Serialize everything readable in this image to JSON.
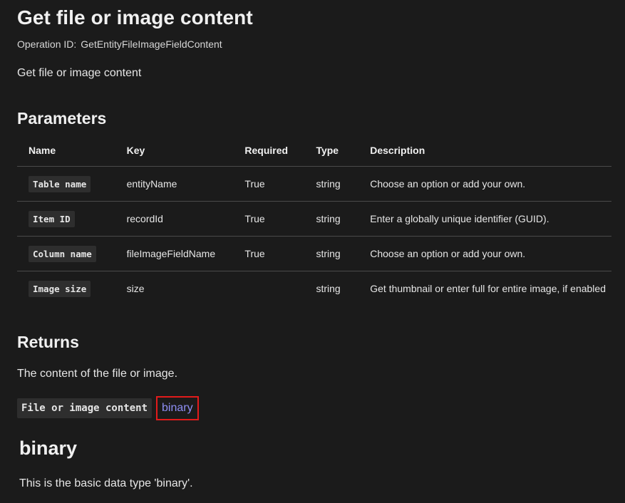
{
  "title": "Get file or image content",
  "operation": {
    "label": "Operation ID:",
    "value": "GetEntityFileImageFieldContent"
  },
  "summary": "Get file or image content",
  "parameters": {
    "heading": "Parameters",
    "columns": [
      "Name",
      "Key",
      "Required",
      "Type",
      "Description"
    ],
    "rows": [
      {
        "name": "Table name",
        "key": "entityName",
        "required": "True",
        "type": "string",
        "description": "Choose an option or add your own."
      },
      {
        "name": "Item ID",
        "key": "recordId",
        "required": "True",
        "type": "string",
        "description": "Enter a globally unique identifier (GUID)."
      },
      {
        "name": "Column name",
        "key": "fileImageFieldName",
        "required": "True",
        "type": "string",
        "description": "Choose an option or add your own."
      },
      {
        "name": "Image size",
        "key": "size",
        "required": "",
        "type": "string",
        "description": "Get thumbnail or enter full for entire image, if enabled"
      }
    ]
  },
  "returns": {
    "heading": "Returns",
    "description": "The content of the file or image.",
    "name": "File or image content",
    "type_link": "binary",
    "highlight_color": "#e21b1b",
    "link_color": "#8f8ff5"
  },
  "binary": {
    "heading": "binary",
    "description": "This is the basic data type 'binary'."
  }
}
